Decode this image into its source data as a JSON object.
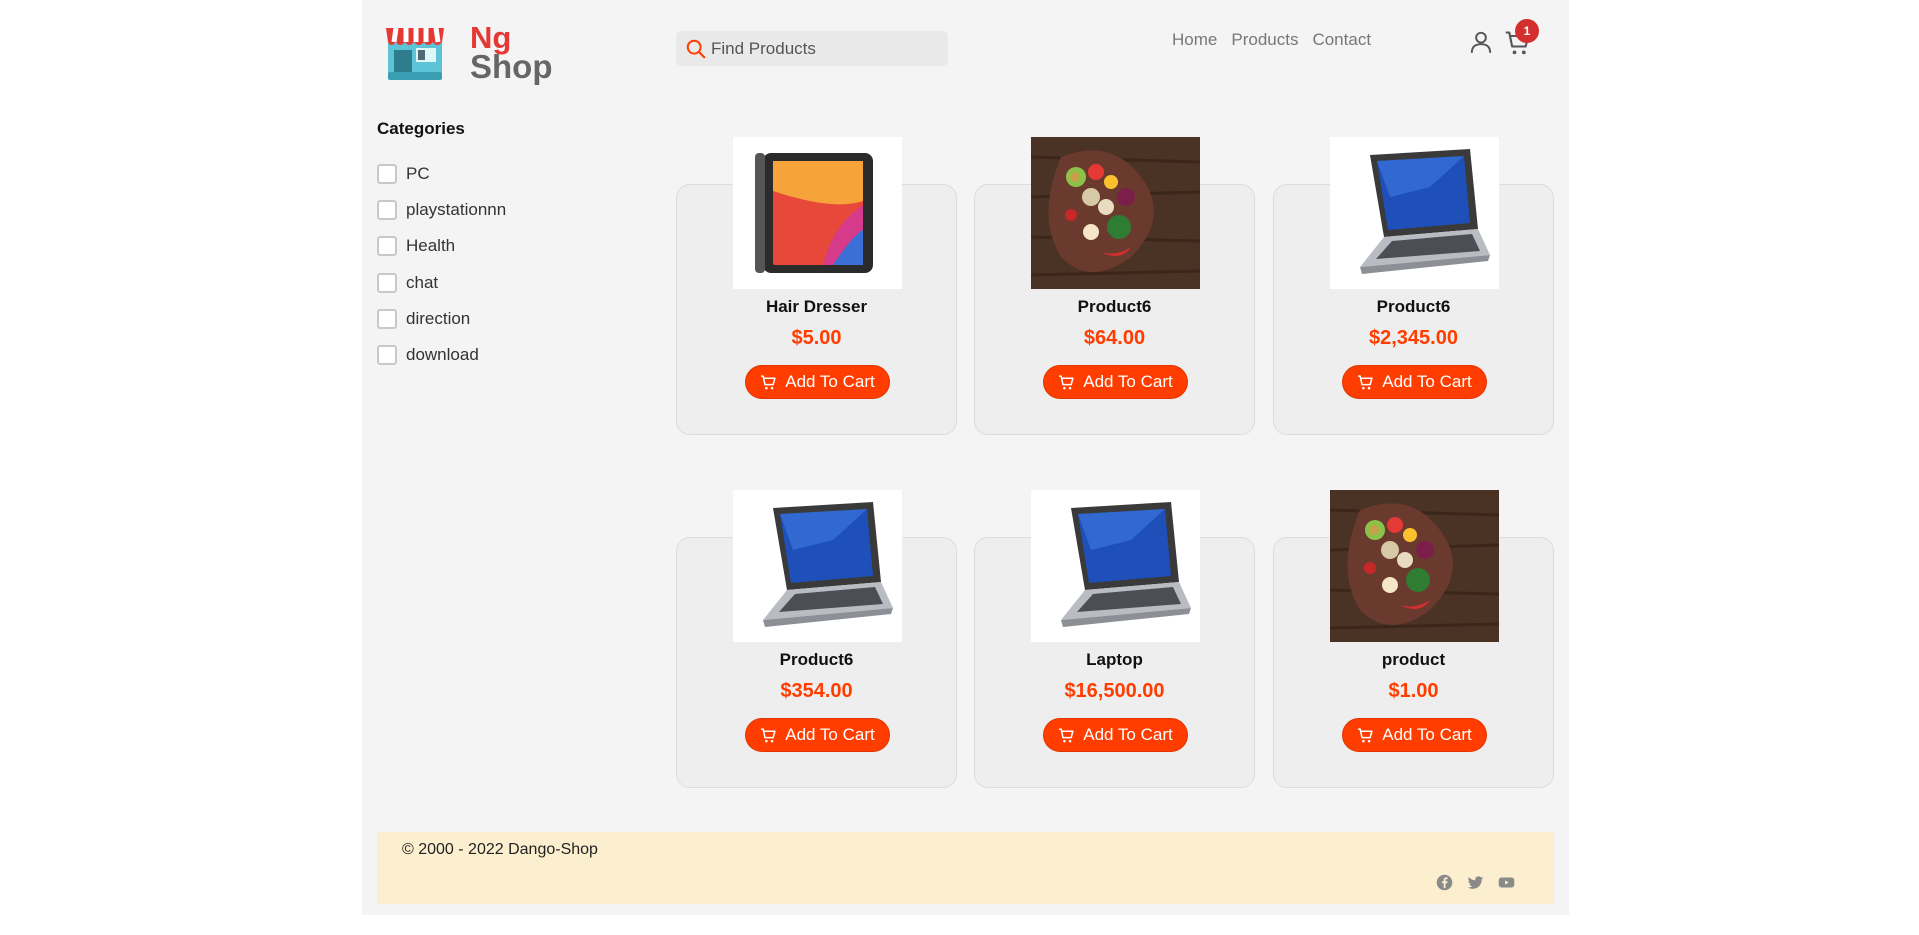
{
  "header": {
    "logo_top": "Ng",
    "logo_bottom": "Shop",
    "search_placeholder": "Find Products",
    "nav": [
      "Home",
      "Products",
      "Contact"
    ],
    "cart_count": "1"
  },
  "categories": {
    "title": "Categories",
    "items": [
      "PC",
      "playstationnn",
      "Health",
      "chat",
      "direction",
      "download"
    ]
  },
  "products": [
    {
      "name": "Hair Dresser",
      "price": "$5.00",
      "image": "tablet",
      "button": "Add To Cart"
    },
    {
      "name": "Product6",
      "price": "$64.00",
      "image": "food",
      "button": "Add To Cart"
    },
    {
      "name": "Product6",
      "price": "$2,345.00",
      "image": "laptop",
      "button": "Add To Cart"
    },
    {
      "name": "Product6",
      "price": "$354.00",
      "image": "laptop",
      "button": "Add To Cart"
    },
    {
      "name": "Laptop",
      "price": "$16,500.00",
      "image": "laptop",
      "button": "Add To Cart"
    },
    {
      "name": "product",
      "price": "$1.00",
      "image": "food",
      "button": "Add To Cart"
    }
  ],
  "footer": {
    "copyright": "© 2000 - 2022 Dango-Shop",
    "social": [
      "facebook-icon",
      "twitter-icon",
      "youtube-icon"
    ]
  },
  "colors": {
    "accent": "#ff3d00",
    "badge": "#d32f2f",
    "footer_bg": "#fcefcf",
    "page_bg": "#f4f4f4"
  }
}
